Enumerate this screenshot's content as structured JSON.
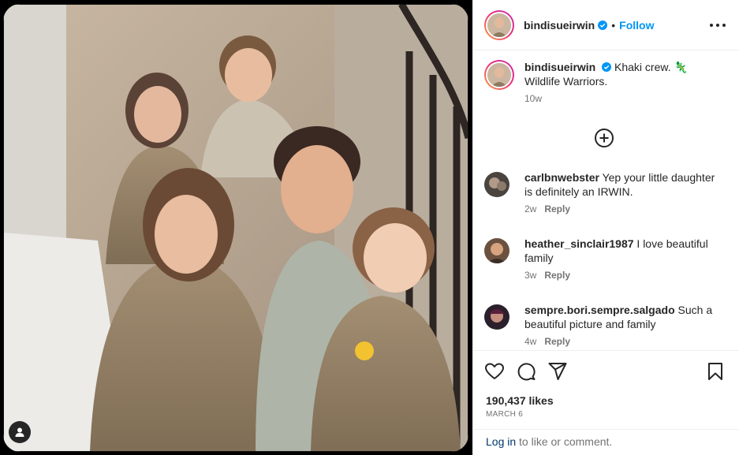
{
  "post": {
    "username": "bindisueirwin",
    "follow_label": "Follow",
    "separator": "•",
    "likes": "190,437 likes",
    "date": "MARCH 6"
  },
  "caption": {
    "username": "bindisueirwin",
    "text": "Khaki crew. 🦎",
    "text_line2": "Wildlife Warriors.",
    "time": "10w"
  },
  "comments": [
    {
      "username": "carlbnwebster",
      "text": "Yep your little daughter is definitely an IRWIN.",
      "time": "2w",
      "reply": "Reply"
    },
    {
      "username": "heather_sinclair1987",
      "text": "I love beautiful family",
      "time": "3w",
      "reply": "Reply"
    },
    {
      "username": "sempre.bori.sempre.salgado",
      "text": "Such a beautiful picture and family",
      "time": "4w",
      "reply": "Reply"
    }
  ],
  "login": {
    "link": "Log in",
    "rest": " to like or comment."
  },
  "icons": {
    "verified": "verified-badge-icon",
    "more": "more-options-icon",
    "load_more": "plus-circle-icon",
    "like": "heart-icon",
    "comment": "comment-bubble-icon",
    "share": "paper-plane-icon",
    "save": "bookmark-icon",
    "user_tag": "user-tag-icon"
  },
  "colors": {
    "accent": "#0095f6",
    "text": "#262626",
    "secondary": "#737373",
    "link": "#00376b",
    "verified": "#0095f6"
  }
}
